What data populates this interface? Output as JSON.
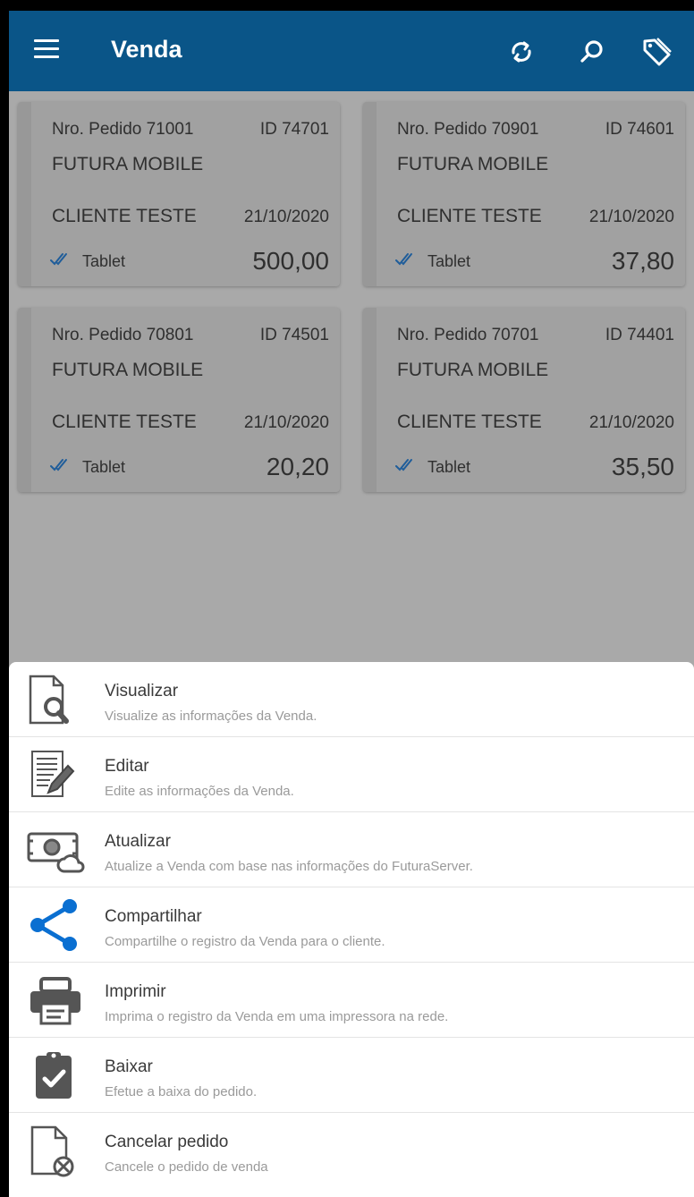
{
  "appbar": {
    "title": "Venda",
    "icons": [
      "menu-icon",
      "sync-icon",
      "search-icon",
      "tag-icon"
    ],
    "color": "#0a5588"
  },
  "orders": [
    {
      "number": "Nro. Pedido 71001",
      "id": "ID 74701",
      "company": "FUTURA MOBILE",
      "client": "CLIENTE TESTE",
      "date": "21/10/2020",
      "device": "Tablet",
      "total": "500,00"
    },
    {
      "number": "Nro. Pedido 70901",
      "id": "ID 74601",
      "company": "FUTURA MOBILE",
      "client": "CLIENTE TESTE",
      "date": "21/10/2020",
      "device": "Tablet",
      "total": "37,80"
    },
    {
      "number": "Nro. Pedido 70801",
      "id": "ID 74501",
      "company": "FUTURA MOBILE",
      "client": "CLIENTE TESTE",
      "date": "21/10/2020",
      "device": "Tablet",
      "total": "20,20"
    },
    {
      "number": "Nro. Pedido 70701",
      "id": "ID 74401",
      "company": "FUTURA MOBILE",
      "client": "CLIENTE TESTE",
      "date": "21/10/2020",
      "device": "Tablet",
      "total": "35,50"
    }
  ],
  "sheet": {
    "options": [
      {
        "label": "Visualizar",
        "description": "Visualize as informações da Venda.",
        "icon": "document-search-icon"
      },
      {
        "label": "Editar",
        "description": "Edite as informações da Venda.",
        "icon": "document-edit-icon"
      },
      {
        "label": "Atualizar",
        "description": "Atualize a Venda com base nas informações do FuturaServer.",
        "icon": "cloud-money-icon"
      },
      {
        "label": "Compartilhar",
        "description": "Compartilhe o registro da Venda para o cliente.",
        "icon": "share-icon"
      },
      {
        "label": "Imprimir",
        "description": "Imprima o registro da Venda em uma impressora na rede.",
        "icon": "printer-icon"
      },
      {
        "label": "Baixar",
        "description": "Efetue a baixa do pedido.",
        "icon": "clipboard-check-icon"
      },
      {
        "label": "Cancelar pedido",
        "description": "Cancele o pedido de venda",
        "icon": "document-cancel-icon"
      }
    ]
  }
}
